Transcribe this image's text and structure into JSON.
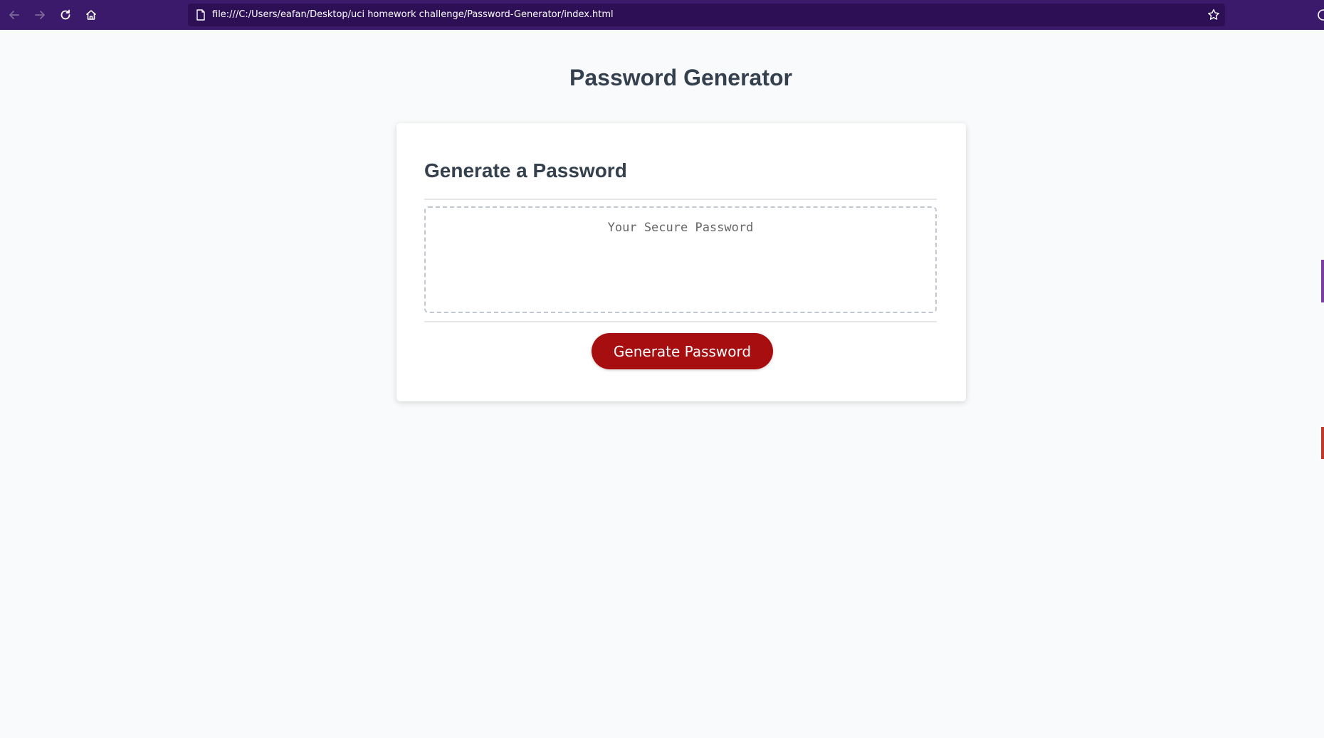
{
  "browser": {
    "url": "file:///C:/Users/eafan/Desktop/uci homework challenge/Password-Generator/index.html",
    "icons": [
      "back-icon",
      "forward-icon",
      "reload-icon",
      "home-icon",
      "document-icon",
      "star-icon"
    ],
    "bar_color": "#3b1a6b",
    "url_bar_color": "#2c0f55"
  },
  "page": {
    "title": "Password Generator"
  },
  "card": {
    "title": "Generate a Password",
    "password_placeholder": "Your Secure Password",
    "password_value": "",
    "generate_label": "Generate Password",
    "button_color": "#a70e10"
  }
}
